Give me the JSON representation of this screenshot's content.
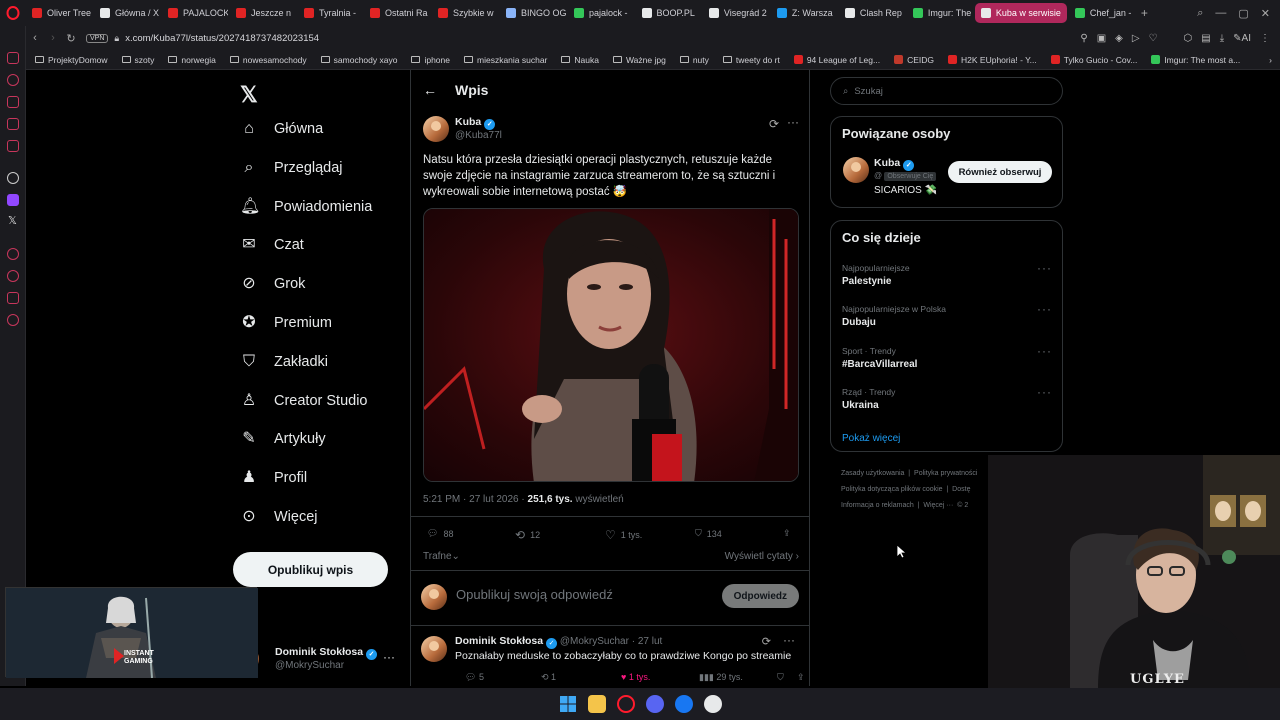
{
  "browser": {
    "tabs": [
      {
        "label": "Oliver Tree",
        "color": "#e02424"
      },
      {
        "label": "Główna / X",
        "color": "#e7e9ea"
      },
      {
        "label": "PAJALOCK",
        "color": "#e02424"
      },
      {
        "label": "Jeszcze n",
        "color": "#e02424"
      },
      {
        "label": "Tyralnia -",
        "color": "#e02424"
      },
      {
        "label": "Ostatni Ra",
        "color": "#e02424"
      },
      {
        "label": "Szybkie w",
        "color": "#e02424"
      },
      {
        "label": "BINGO OG",
        "color": "#8ab4f8"
      },
      {
        "label": "pajalock -",
        "color": "#34c759"
      },
      {
        "label": "BOOP.PL",
        "color": "#e7e9ea"
      },
      {
        "label": "Visegrád 2",
        "color": "#e7e9ea"
      },
      {
        "label": "Z: Warsza",
        "color": "#1d9bf0"
      },
      {
        "label": "Clash Rep",
        "color": "#e7e9ea"
      },
      {
        "label": "Imgur: The",
        "color": "#34c759"
      },
      {
        "label": "Kuba w serwisie",
        "color": "#e7e9ea",
        "active": true
      },
      {
        "label": "Chef_jan -",
        "color": "#34c759"
      }
    ],
    "address": {
      "vpn": "VPN",
      "url": "x.com/Kuba77l/status/2027418737482023154",
      "ai_label": "AI"
    },
    "bookmarks": [
      {
        "label": "ProjektyDomow",
        "type": "folder"
      },
      {
        "label": "szoty",
        "type": "folder"
      },
      {
        "label": "norwegia",
        "type": "folder"
      },
      {
        "label": "nowesamochody",
        "type": "folder"
      },
      {
        "label": "samochody xayo",
        "type": "folder"
      },
      {
        "label": "iphone",
        "type": "folder"
      },
      {
        "label": "mieszkania suchar",
        "type": "folder"
      },
      {
        "label": "Nauka",
        "type": "folder"
      },
      {
        "label": "Ważne jpg",
        "type": "folder"
      },
      {
        "label": "nuty",
        "type": "folder"
      },
      {
        "label": "tweety do rt",
        "type": "folder"
      },
      {
        "label": "94 League of Leg...",
        "type": "site",
        "color": "#e02424"
      },
      {
        "label": "CEIDG",
        "type": "site",
        "color": "#c0392b"
      },
      {
        "label": "H2K EUphoria! - Y...",
        "type": "site",
        "color": "#e02424"
      },
      {
        "label": "Tylko Gucio - Cov...",
        "type": "site",
        "color": "#e02424"
      },
      {
        "label": "Imgur: The most a...",
        "type": "site",
        "color": "#34c759"
      }
    ]
  },
  "x": {
    "nav": [
      {
        "label": "Główna",
        "icon": "home-icon"
      },
      {
        "label": "Przeglądaj",
        "icon": "search-icon"
      },
      {
        "label": "Powiadomienia",
        "icon": "bell-icon"
      },
      {
        "label": "Czat",
        "icon": "mail-icon"
      },
      {
        "label": "Grok",
        "icon": "grok-icon"
      },
      {
        "label": "Premium",
        "icon": "premium-icon"
      },
      {
        "label": "Zakładki",
        "icon": "bookmark-icon"
      },
      {
        "label": "Creator Studio",
        "icon": "creator-icon"
      },
      {
        "label": "Artykuły",
        "icon": "article-icon"
      },
      {
        "label": "Profil",
        "icon": "profile-icon"
      },
      {
        "label": "Więcej",
        "icon": "more-icon"
      }
    ],
    "post_button": "Opublikuj wpis",
    "account": {
      "name": "Dominik Stokłosa",
      "handle": "@MokrySuchar"
    },
    "header_title": "Wpis",
    "tweet": {
      "author": "Kuba",
      "handle": "@Kuba77l",
      "text": "Natsu która przesła dziesiątki operacji plastycznych, retuszuje każde swoje zdjęcie na instagramie zarzuca streamerom to, że są sztuczni i wykreowali sobie internetową postać 🤯",
      "time": "5:21 PM · 27 lut 2026 · ",
      "views": "251,6 tys.",
      "views_label": " wyświetleń",
      "replies": "88",
      "reposts": "12",
      "likes": "1 tys.",
      "bookmarks": "134"
    },
    "sort_label": "Trafne",
    "view_quotes": "Wyświetl cytaty",
    "compose_placeholder": "Opublikuj swoją odpowiedź",
    "reply_button": "Odpowiedz",
    "reply": {
      "author": "Dominik Stokłosa",
      "handle": "@MokrySuchar",
      "time": "· 27 lut",
      "text": "Poznałaby meduske to zobaczyłaby co to prawdziwe Kongo po streamie",
      "replies": "5",
      "reposts": "1",
      "likes": "1 tys.",
      "views": "29 tys."
    },
    "search_placeholder": "Szukaj",
    "related": {
      "title": "Powiązane osoby",
      "name": "Kuba",
      "handle": "@",
      "follows_you": "Obserwuje Cię",
      "bio": "SICARIOS 💸",
      "button": "Również obserwuj"
    },
    "trends": {
      "title": "Co się dzieje",
      "items": [
        {
          "context": "Najpopularniejsze",
          "name": "Palestynie"
        },
        {
          "context": "Najpopularniejsze w Polska",
          "name": "Dubaju"
        },
        {
          "context": "Sport · Trendy",
          "name": "#BarcaVillarreal"
        },
        {
          "context": "Rząd · Trendy",
          "name": "Ukraina"
        }
      ],
      "show_more": "Pokaż więcej"
    },
    "footer": {
      "line1a": "Zasady użytkowania",
      "line1b": "Polityka prywatności",
      "line2a": "Polityka dotycząca plików cookie",
      "line2b": "Dostę",
      "line3a": "Informacja o reklamach",
      "line3b": "Więcej ···",
      "line3c": "© 2"
    }
  },
  "overlay": {
    "game_caption_1": "INSTANT",
    "game_caption_2": "GAMING",
    "hoodie_text": "UGLYE"
  }
}
